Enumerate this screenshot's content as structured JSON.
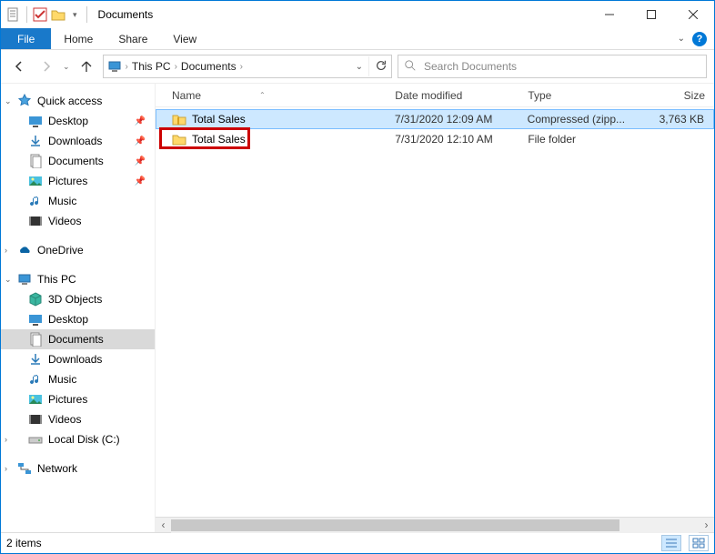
{
  "window": {
    "title": "Documents"
  },
  "ribbon": {
    "file": "File",
    "home": "Home",
    "share": "Share",
    "view": "View"
  },
  "address": {
    "root": "This PC",
    "folder": "Documents"
  },
  "search": {
    "placeholder": "Search Documents"
  },
  "nav": {
    "quick_access": "Quick access",
    "desktop": "Desktop",
    "downloads": "Downloads",
    "documents": "Documents",
    "pictures": "Pictures",
    "music": "Music",
    "videos": "Videos",
    "onedrive": "OneDrive",
    "this_pc": "This PC",
    "objects3d": "3D Objects",
    "desktop2": "Desktop",
    "documents2": "Documents",
    "downloads2": "Downloads",
    "music2": "Music",
    "pictures2": "Pictures",
    "videos2": "Videos",
    "localdisk": "Local Disk (C:)",
    "network": "Network"
  },
  "columns": {
    "name": "Name",
    "date": "Date modified",
    "type": "Type",
    "size": "Size"
  },
  "files": [
    {
      "name": "Total Sales",
      "date": "7/31/2020 12:09 AM",
      "type": "Compressed (zipp...",
      "size": "3,763 KB",
      "icon": "zip",
      "selected": true
    },
    {
      "name": "Total Sales",
      "date": "7/31/2020 12:10 AM",
      "type": "File folder",
      "size": "",
      "icon": "folder",
      "selected": false
    }
  ],
  "status": {
    "items": "2 items"
  }
}
